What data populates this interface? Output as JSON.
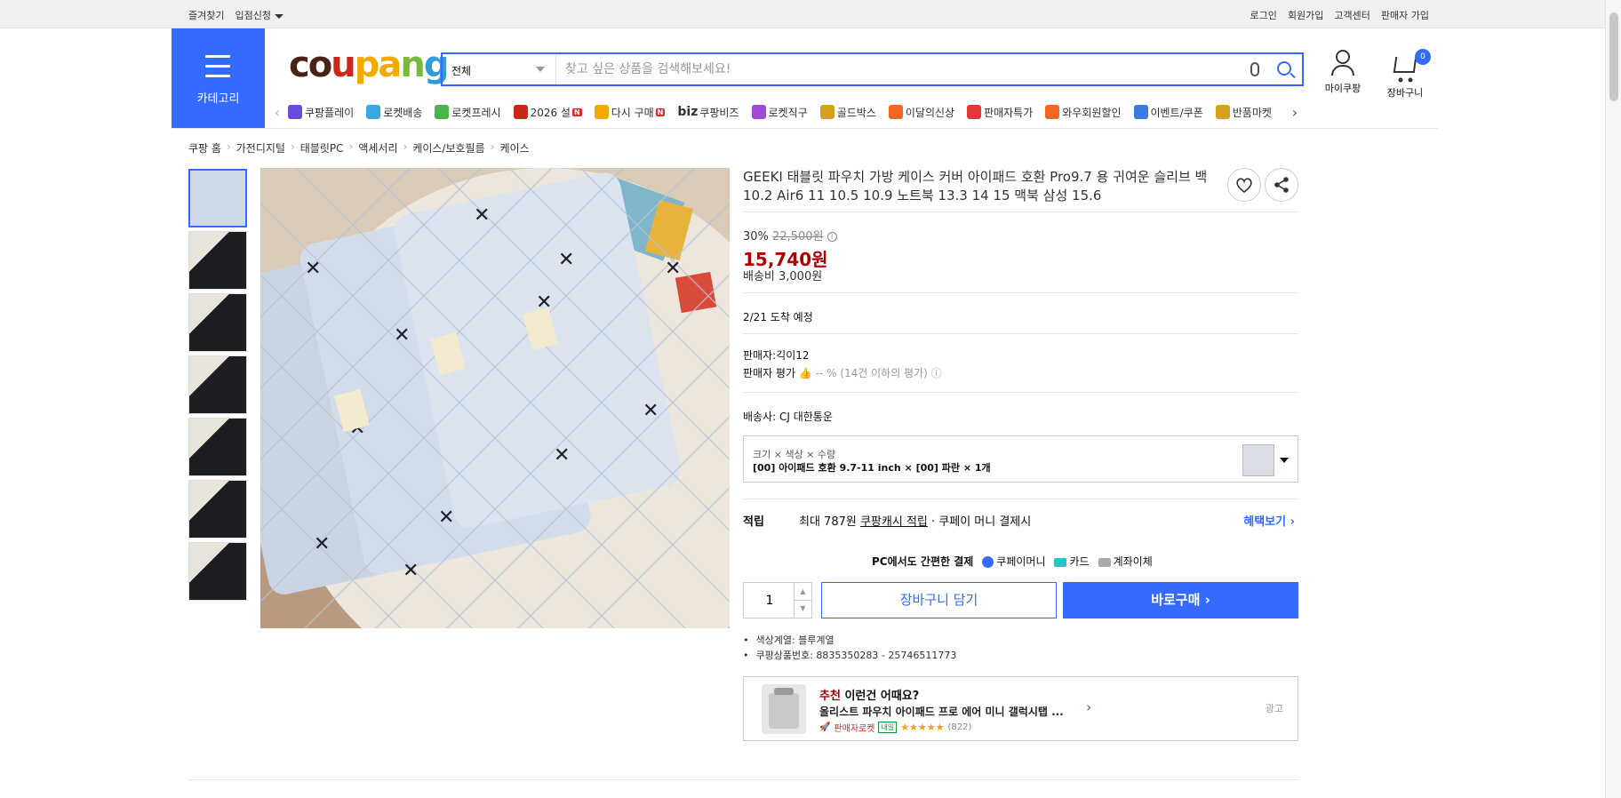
{
  "topbar": {
    "left": [
      "즐겨찾기",
      "입점신청"
    ],
    "right": [
      "로그인",
      "회원가입",
      "고객센터",
      "판매자 가입"
    ]
  },
  "header": {
    "category_label": "카테고리",
    "logo": {
      "letters": [
        "c",
        "o",
        "u",
        "p",
        "a",
        "n",
        "g"
      ],
      "colors": [
        "#4a2216",
        "#4a2216",
        "#c8281a",
        "#f2a900",
        "#f2a900",
        "#7bb93a",
        "#2d9ed9"
      ]
    },
    "search_scope": "전체",
    "search_placeholder": "찾고 싶은 상품을 검색해보세요!",
    "mycoupang": "마이쿠팡",
    "cart": "장바구니",
    "cart_count": "0"
  },
  "nav": [
    {
      "label": "쿠팡플레이",
      "color": "#6a4ad9"
    },
    {
      "label": "로켓배송",
      "color": "#3aa7e0"
    },
    {
      "label": "로켓프레시",
      "color": "#4db348"
    },
    {
      "label": "2026 설",
      "color": "#c8281a",
      "badge": true
    },
    {
      "label": "다시 구매",
      "color": "#f2a900",
      "badge": true
    },
    {
      "label": "쿠팡비즈",
      "color": "#333333",
      "prefix": "biz"
    },
    {
      "label": "로켓직구",
      "color": "#a04ad9"
    },
    {
      "label": "골드박스",
      "color": "#d6a21c"
    },
    {
      "label": "이달의신상",
      "color": "#f26522"
    },
    {
      "label": "판매자특가",
      "color": "#e03a3a"
    },
    {
      "label": "와우회원할인",
      "color": "#f26522"
    },
    {
      "label": "이벤트/쿠폰",
      "color": "#3a7be0"
    },
    {
      "label": "반품마켓",
      "color": "#d6a21c"
    }
  ],
  "breadcrumb": [
    "쿠팡 홈",
    "가전디지털",
    "태블릿PC",
    "액세서리",
    "케이스/보호필름",
    "케이스"
  ],
  "product": {
    "title": "GEEKI 태블릿 파우치 가방 케이스 커버 아이패드 호환 Pro9.7 용 귀여운 슬리브 백 10.2 Air6 11 10.5 10.9 노트북 13.3 14 15 맥북 삼성 15.6",
    "discount": "30%",
    "original_price": "22,500원",
    "price": "15,740원",
    "shipping_fee": "배송비 3,000원",
    "arrival": "2/21 도착 예정",
    "seller": "판매자:긱이12",
    "seller_rating_label": "판매자 평가",
    "seller_rating_value": "-- % (14건 이하의 평가)",
    "carrier": "배송사:  CJ 대한통운",
    "option_header": "크기 × 색상 × 수량",
    "option_value": "[00] 아이패드 호환 9.7-11 inch × [00] 파란 × 1개",
    "reward_label": "적립",
    "reward_pre": "최대 787원",
    "reward_link": "쿠팡캐시 적립",
    "reward_post": "· 쿠페이 머니 결제시",
    "reward_more": "혜택보기 ›",
    "pay_label": "PC에서도 간편한 결제",
    "pay_methods": [
      "쿠페이머니",
      "카드",
      "계좌이체"
    ],
    "quantity": "1",
    "cart_button": "장바구니 담기",
    "buy_button": "바로구매 ›",
    "bullets": [
      "색상계열: 블루계열",
      "쿠팡상품번호: 8835350283 - 25746511773"
    ]
  },
  "ad": {
    "title_red": "추천",
    "title_rest": " 이런건 어때요?",
    "product": "올리스트 파우치 아이패드 프로 에어 미니 갤럭시탭 ...",
    "badge": "판매자로켓",
    "tag": "내일",
    "stars": "★★★★★",
    "count": "(822)",
    "ad_label": "광고"
  }
}
